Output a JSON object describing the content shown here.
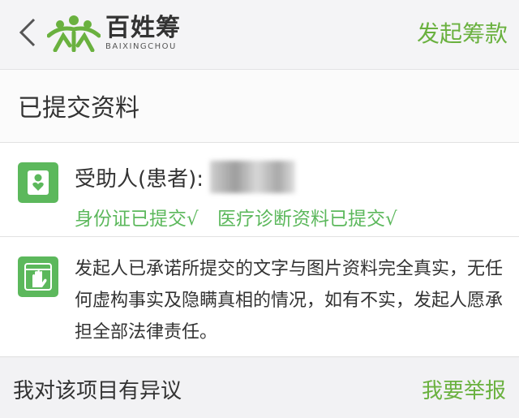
{
  "header": {
    "logo_cn": "百姓筹",
    "logo_en": "BAIXINGCHOU",
    "launch_label": "发起筹款"
  },
  "section_title": "已提交资料",
  "recipient": {
    "label": "受助人(患者):",
    "status": [
      "身份证已提交√",
      "医疗诊断资料已提交√"
    ]
  },
  "promise": {
    "text": "发起人已承诺所提交的文字与图片资料完全真实，无任何虚构事实及隐瞒真相的情况，如有不实，发起人愿承担全部法律责任。"
  },
  "dispute": {
    "label": "我对该项目有异议",
    "report_label": "我要举报"
  },
  "colors": {
    "accent": "#6ab13f",
    "icon_bg": "#5cb85c"
  }
}
